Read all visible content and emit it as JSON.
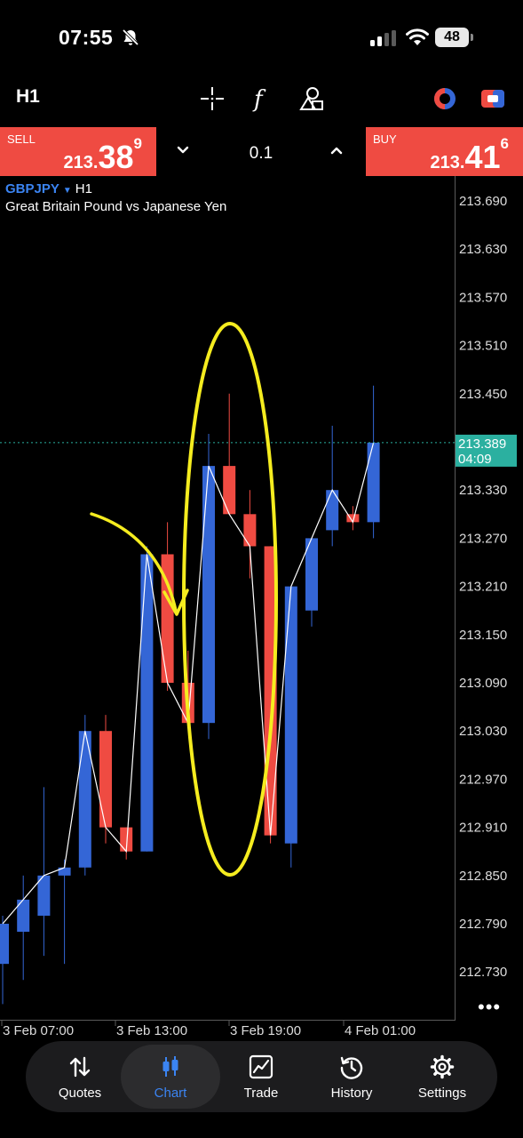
{
  "status_bar": {
    "time": "07:55",
    "battery": "48"
  },
  "toolbar": {
    "timeframe": "H1"
  },
  "trade_bar": {
    "sell": {
      "label": "SELL",
      "price_small": "213.",
      "price_big": "38",
      "price_sup": "9"
    },
    "buy": {
      "label": "BUY",
      "price_small": "213.",
      "price_big": "41",
      "price_sup": "6"
    },
    "lot": "0.1"
  },
  "chart": {
    "symbol": "GBPJPY",
    "timeframe": "H1",
    "description": "Great Britain Pound vs Japanese Yen",
    "price_labels": [
      "213.690",
      "213.630",
      "213.570",
      "213.510",
      "213.450",
      "213.330",
      "213.270",
      "213.210",
      "213.150",
      "213.090",
      "213.030",
      "212.970",
      "212.910",
      "212.850",
      "212.790",
      "212.730"
    ],
    "current_price": "213.389",
    "countdown": "04:09",
    "time_labels": [
      "3 Feb 07:00",
      "3 Feb 13:00",
      "3 Feb 19:00",
      "4 Feb 01:00"
    ],
    "colors": {
      "up": "#3466d6",
      "down": "#ef4b42",
      "line": "#ffffff",
      "annotation": "#f5ec1f",
      "current": "#2bb0a0"
    }
  },
  "chart_data": {
    "type": "candlestick",
    "symbol": "GBPJPY",
    "timeframe": "H1",
    "ylim": [
      212.69,
      213.72
    ],
    "candles": [
      {
        "o": 212.74,
        "h": 212.8,
        "l": 212.69,
        "c": 212.79
      },
      {
        "o": 212.78,
        "h": 212.85,
        "l": 212.72,
        "c": 212.82
      },
      {
        "o": 212.8,
        "h": 212.96,
        "l": 212.75,
        "c": 212.85
      },
      {
        "o": 212.85,
        "h": 212.87,
        "l": 212.74,
        "c": 212.86
      },
      {
        "o": 212.86,
        "h": 213.05,
        "l": 212.85,
        "c": 213.03
      },
      {
        "o": 213.03,
        "h": 213.05,
        "l": 212.89,
        "c": 212.91
      },
      {
        "o": 212.91,
        "h": 212.91,
        "l": 212.87,
        "c": 212.88
      },
      {
        "o": 212.88,
        "h": 213.26,
        "l": 212.88,
        "c": 213.25
      },
      {
        "o": 213.25,
        "h": 213.29,
        "l": 213.08,
        "c": 213.09
      },
      {
        "o": 213.09,
        "h": 213.13,
        "l": 213.04,
        "c": 213.04
      },
      {
        "o": 213.04,
        "h": 213.4,
        "l": 213.02,
        "c": 213.36
      },
      {
        "o": 213.36,
        "h": 213.45,
        "l": 213.3,
        "c": 213.3
      },
      {
        "o": 213.3,
        "h": 213.33,
        "l": 213.22,
        "c": 213.26
      },
      {
        "o": 213.26,
        "h": 213.26,
        "l": 212.89,
        "c": 212.9
      },
      {
        "o": 212.89,
        "h": 213.21,
        "l": 212.86,
        "c": 213.21
      },
      {
        "o": 213.18,
        "h": 213.27,
        "l": 213.16,
        "c": 213.27
      },
      {
        "o": 213.28,
        "h": 213.41,
        "l": 213.26,
        "c": 213.33
      },
      {
        "o": 213.3,
        "h": 213.31,
        "l": 213.28,
        "c": 213.29
      },
      {
        "o": 213.29,
        "h": 213.46,
        "l": 213.27,
        "c": 213.389
      }
    ],
    "current_price": 213.389,
    "grid": false,
    "annotations": [
      "yellow-arrow",
      "yellow-ellipse"
    ]
  },
  "nav": {
    "items": [
      {
        "label": "Quotes",
        "icon": "quotes-icon"
      },
      {
        "label": "Chart",
        "icon": "chart-icon"
      },
      {
        "label": "Trade",
        "icon": "trade-icon"
      },
      {
        "label": "History",
        "icon": "history-icon"
      },
      {
        "label": "Settings",
        "icon": "settings-icon"
      }
    ]
  }
}
